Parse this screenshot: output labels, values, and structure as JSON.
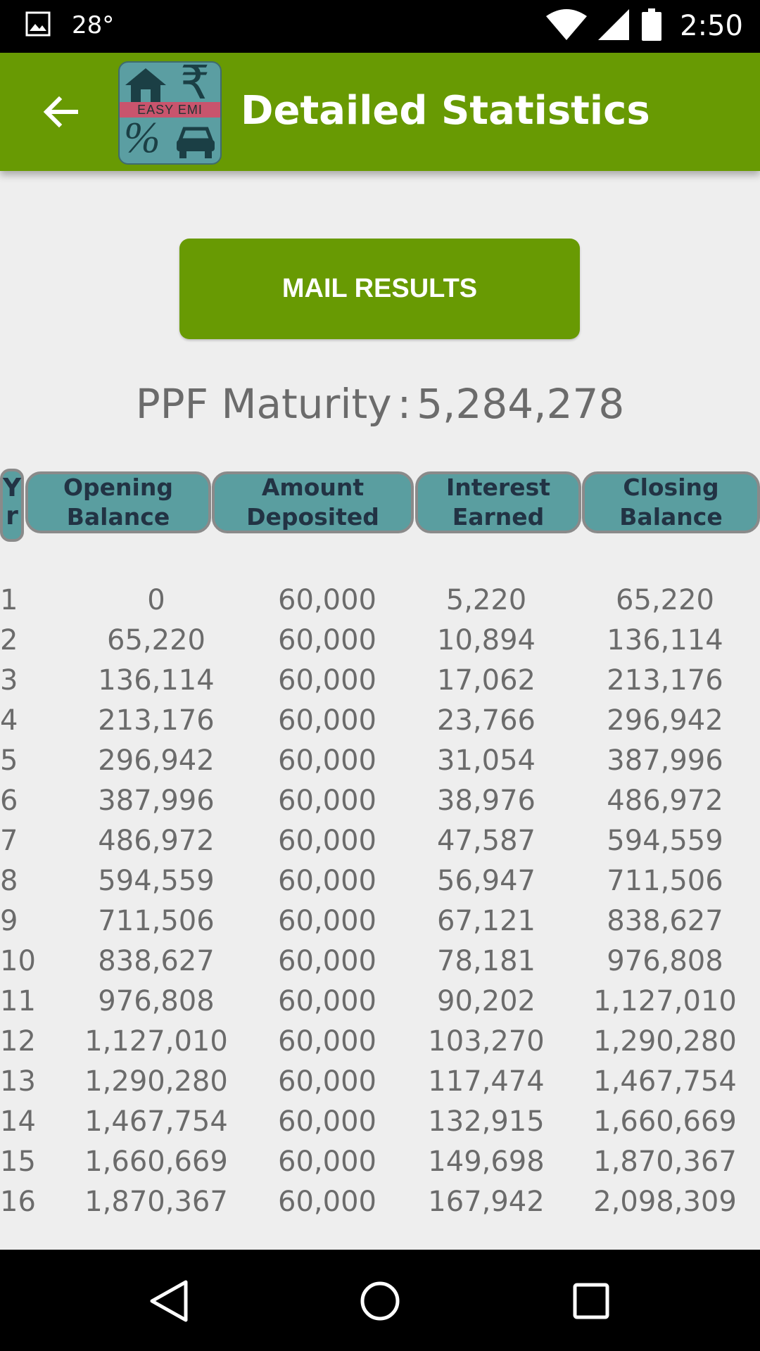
{
  "status_bar": {
    "temperature": "28°",
    "time": "2:50"
  },
  "app_bar": {
    "title": "Detailed Statistics",
    "logo_text": "EASY EMI",
    "logo_percent": "%",
    "logo_rupee": "₹"
  },
  "actions": {
    "mail_results": "MAIL RESULTS"
  },
  "summary": {
    "label": "PPF Maturity",
    "separator": ":",
    "value": "5,284,278"
  },
  "table": {
    "headers": {
      "year_line1": "Y",
      "year_line2": "r",
      "opening_line1": "Opening",
      "opening_line2": "Balance",
      "deposited_line1": "Amount",
      "deposited_line2": "Deposited",
      "interest_line1": "Interest",
      "interest_line2": "Earned",
      "closing_line1": "Closing",
      "closing_line2": "Balance"
    },
    "rows": [
      [
        "1",
        "0",
        "60,000",
        "5,220",
        "65,220"
      ],
      [
        "2",
        "65,220",
        "60,000",
        "10,894",
        "136,114"
      ],
      [
        "3",
        "136,114",
        "60,000",
        "17,062",
        "213,176"
      ],
      [
        "4",
        "213,176",
        "60,000",
        "23,766",
        "296,942"
      ],
      [
        "5",
        "296,942",
        "60,000",
        "31,054",
        "387,996"
      ],
      [
        "6",
        "387,996",
        "60,000",
        "38,976",
        "486,972"
      ],
      [
        "7",
        "486,972",
        "60,000",
        "47,587",
        "594,559"
      ],
      [
        "8",
        "594,559",
        "60,000",
        "56,947",
        "711,506"
      ],
      [
        "9",
        "711,506",
        "60,000",
        "67,121",
        "838,627"
      ],
      [
        "10",
        "838,627",
        "60,000",
        "78,181",
        "976,808"
      ],
      [
        "11",
        "976,808",
        "60,000",
        "90,202",
        "1,127,010"
      ],
      [
        "12",
        "1,127,010",
        "60,000",
        "103,270",
        "1,290,280"
      ],
      [
        "13",
        "1,290,280",
        "60,000",
        "117,474",
        "1,467,754"
      ],
      [
        "14",
        "1,467,754",
        "60,000",
        "132,915",
        "1,660,669"
      ],
      [
        "15",
        "1,660,669",
        "60,000",
        "149,698",
        "1,870,367"
      ],
      [
        "16",
        "1,870,367",
        "60,000",
        "167,942",
        "2,098,309"
      ]
    ]
  },
  "colors": {
    "accent": "#689a03",
    "header_fill": "#5a9ea0",
    "text_gray": "#6b6b6b"
  }
}
